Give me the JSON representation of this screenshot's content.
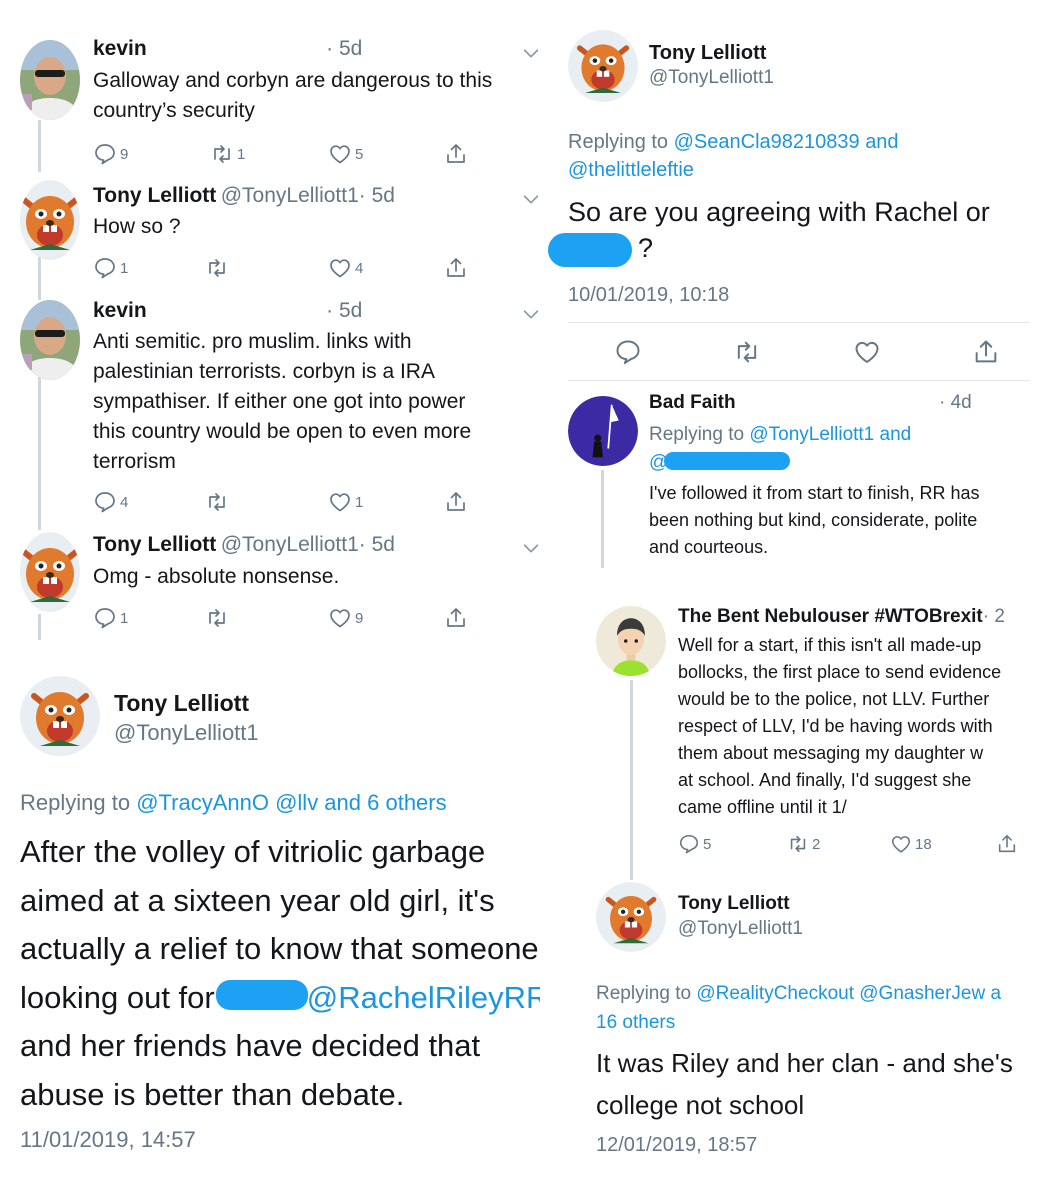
{
  "left_thread": [
    {
      "name": "kevin",
      "handle": "",
      "time": "· 5d",
      "text_lines": [
        "Galloway and corbyn are dangerous to this",
        "country’s security"
      ],
      "replies": "9",
      "retweets": "1",
      "likes": "5"
    },
    {
      "name": "Tony Lelliott",
      "handle": "@TonyLelliott1",
      "time": "· 5d",
      "text_lines": [
        "How so ?"
      ],
      "replies": "1",
      "retweets": "",
      "likes": "4"
    },
    {
      "name": "kevin",
      "handle": "",
      "time": "· 5d",
      "text_lines": [
        "Anti semitic. pro muslim. links with",
        "palestinian terrorists. corbyn is a IRA",
        "sympathiser. If either one got into power",
        "this country would be open to even more",
        "terrorism"
      ],
      "replies": "4",
      "retweets": "",
      "likes": "1"
    },
    {
      "name": "Tony Lelliott",
      "handle": "@TonyLelliott1",
      "time": "· 5d",
      "text_lines": [
        "Omg - absolute nonsense."
      ],
      "replies": "1",
      "retweets": "",
      "likes": "9"
    }
  ],
  "left_detail": {
    "name": "Tony Lelliott",
    "handle": "@TonyLelliott1",
    "replying": [
      "Replying to",
      "@TracyAnnO @llv and 6 others"
    ],
    "text_lines": [
      "After the volley of vitriolic garbage",
      "aimed at a sixteen year old girl, it's",
      "actually a relief to know that someone",
      "looking out for",
      "@RachelRileyRR",
      "and her friends have decided that",
      "abuse is better than debate."
    ],
    "timestamp": "11/01/2019, 14:57"
  },
  "right_detail": {
    "name": "Tony Lelliott",
    "handle": "@TonyLelliott1",
    "replying_line1": [
      "Replying to",
      "@SeanCla98210839 and"
    ],
    "replying_line2": "@thelittleleftie",
    "text_line1": "So are you agreeing with Rachel or",
    "text_line2": "?",
    "timestamp": "10/01/2019, 10:18"
  },
  "bad_faith": {
    "name": "Bad Faith",
    "time": "· 4d",
    "replying": [
      "Replying to",
      "@TonyLelliott1 and",
      "@"
    ],
    "text_lines": [
      "I've followed it from start to finish, RR has",
      "been nothing but kind, considerate, polite",
      "and courteous."
    ]
  },
  "bent": {
    "name": "The Bent Nebulouser #WTOBrexit",
    "time": "· 2",
    "text_lines": [
      "Well for a start, if this isn't all made-up",
      "bollocks, the first place to send evidence",
      "would be to the police, not LLV. Further",
      "respect of LLV, I'd be having words with",
      "them about messaging my daughter w",
      "at school. And finally, I'd suggest she",
      "came offline until it 1/"
    ],
    "replies": "5",
    "retweets": "2",
    "likes": "18"
  },
  "right_bottom": {
    "name": "Tony Lelliott",
    "handle": "@TonyLelliott1",
    "replying_line1": [
      "Replying to",
      "@RealityCheckout @GnasherJew a"
    ],
    "replying_line2": "16 others",
    "text_lines": [
      "It was Riley and her clan - and she's",
      "college not school"
    ],
    "timestamp": "12/01/2019, 18:57"
  },
  "colors": {
    "link": "#1b95e0",
    "grey": "#657786",
    "redaction": "#1da1f2",
    "text": "#14171a"
  },
  "icons": [
    "reply-icon",
    "retweet-icon",
    "like-icon",
    "share-icon",
    "chevron-down-icon"
  ]
}
